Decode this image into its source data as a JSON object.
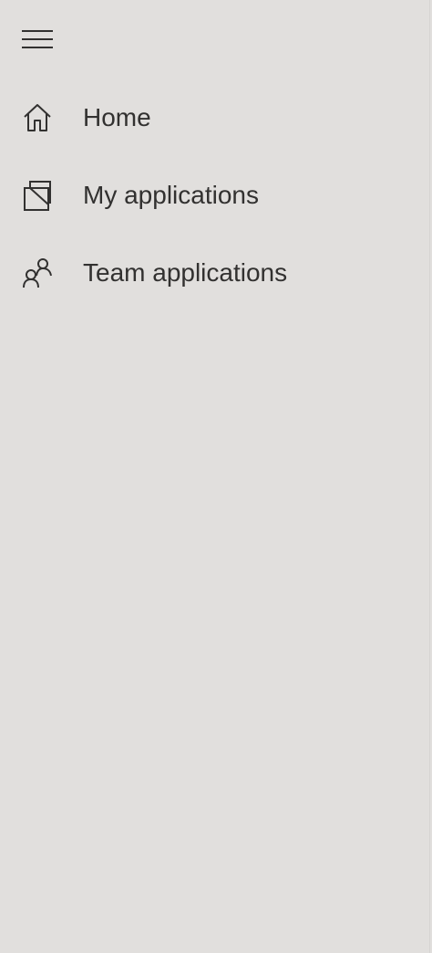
{
  "nav": {
    "menu_icon": "hamburger-menu-icon",
    "items": [
      {
        "label": "Home",
        "icon": "home-icon"
      },
      {
        "label": "My applications",
        "icon": "stacked-windows-icon"
      },
      {
        "label": "Team applications",
        "icon": "people-icon"
      }
    ]
  },
  "colors": {
    "background": "#e1dfdd",
    "text": "#323130",
    "icon_stroke": "#323130"
  }
}
